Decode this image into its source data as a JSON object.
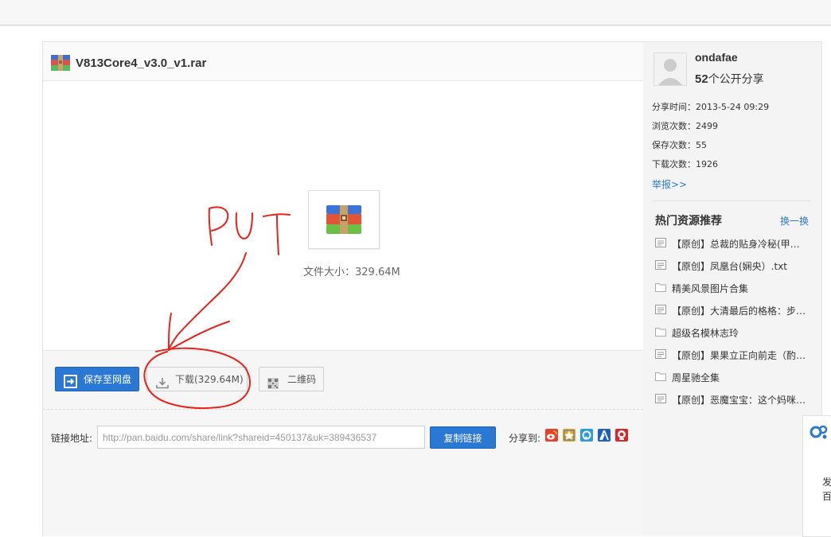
{
  "file": {
    "name": "V813Core4_v3.0_v1.rar",
    "size_text": "文件大小：329.64M"
  },
  "actions": {
    "save_label": "保存至网盘",
    "download_label": "下载(329.64M)",
    "qrcode_label": "二维码",
    "copy_label": "复制链接"
  },
  "link": {
    "label": "链接地址:",
    "value": "http://pan.baidu.com/share/link?shareid=450137&uk=389436537"
  },
  "share": {
    "label": "分享到:",
    "icons": [
      "weibo-icon",
      "qzone-icon",
      "qq-weibo-icon",
      "renren-icon",
      "kaixin-icon"
    ]
  },
  "user": {
    "name": "ondafae",
    "share_count": "52",
    "share_suffix": "个公开分享"
  },
  "stats": [
    "分享时间：2013-5-24 09:29",
    "浏览次数：2499",
    "保存次数：55",
    "下载次数：1926"
  ],
  "report_label": "举报>>",
  "hot": {
    "title": "热门资源推荐",
    "change_label": "换一换",
    "items": [
      "【原创】总裁的贴身冷秘(甲…",
      "【原创】凤凰台(娴央）.txt",
      "精美风景图片合集",
      "【原创】大清最后的格格：步…",
      "超级名模林志玲",
      "【原创】果果立正向前走（酌…",
      "周星驰全集",
      "【原创】恶魔宝宝：这个妈咪…"
    ]
  },
  "annotation_text": "PUT",
  "side_widget": {
    "line1": "发",
    "line2": "百"
  },
  "colors": {
    "primary_blue": "#2b78d4",
    "annotation_red": "#e8231b"
  }
}
